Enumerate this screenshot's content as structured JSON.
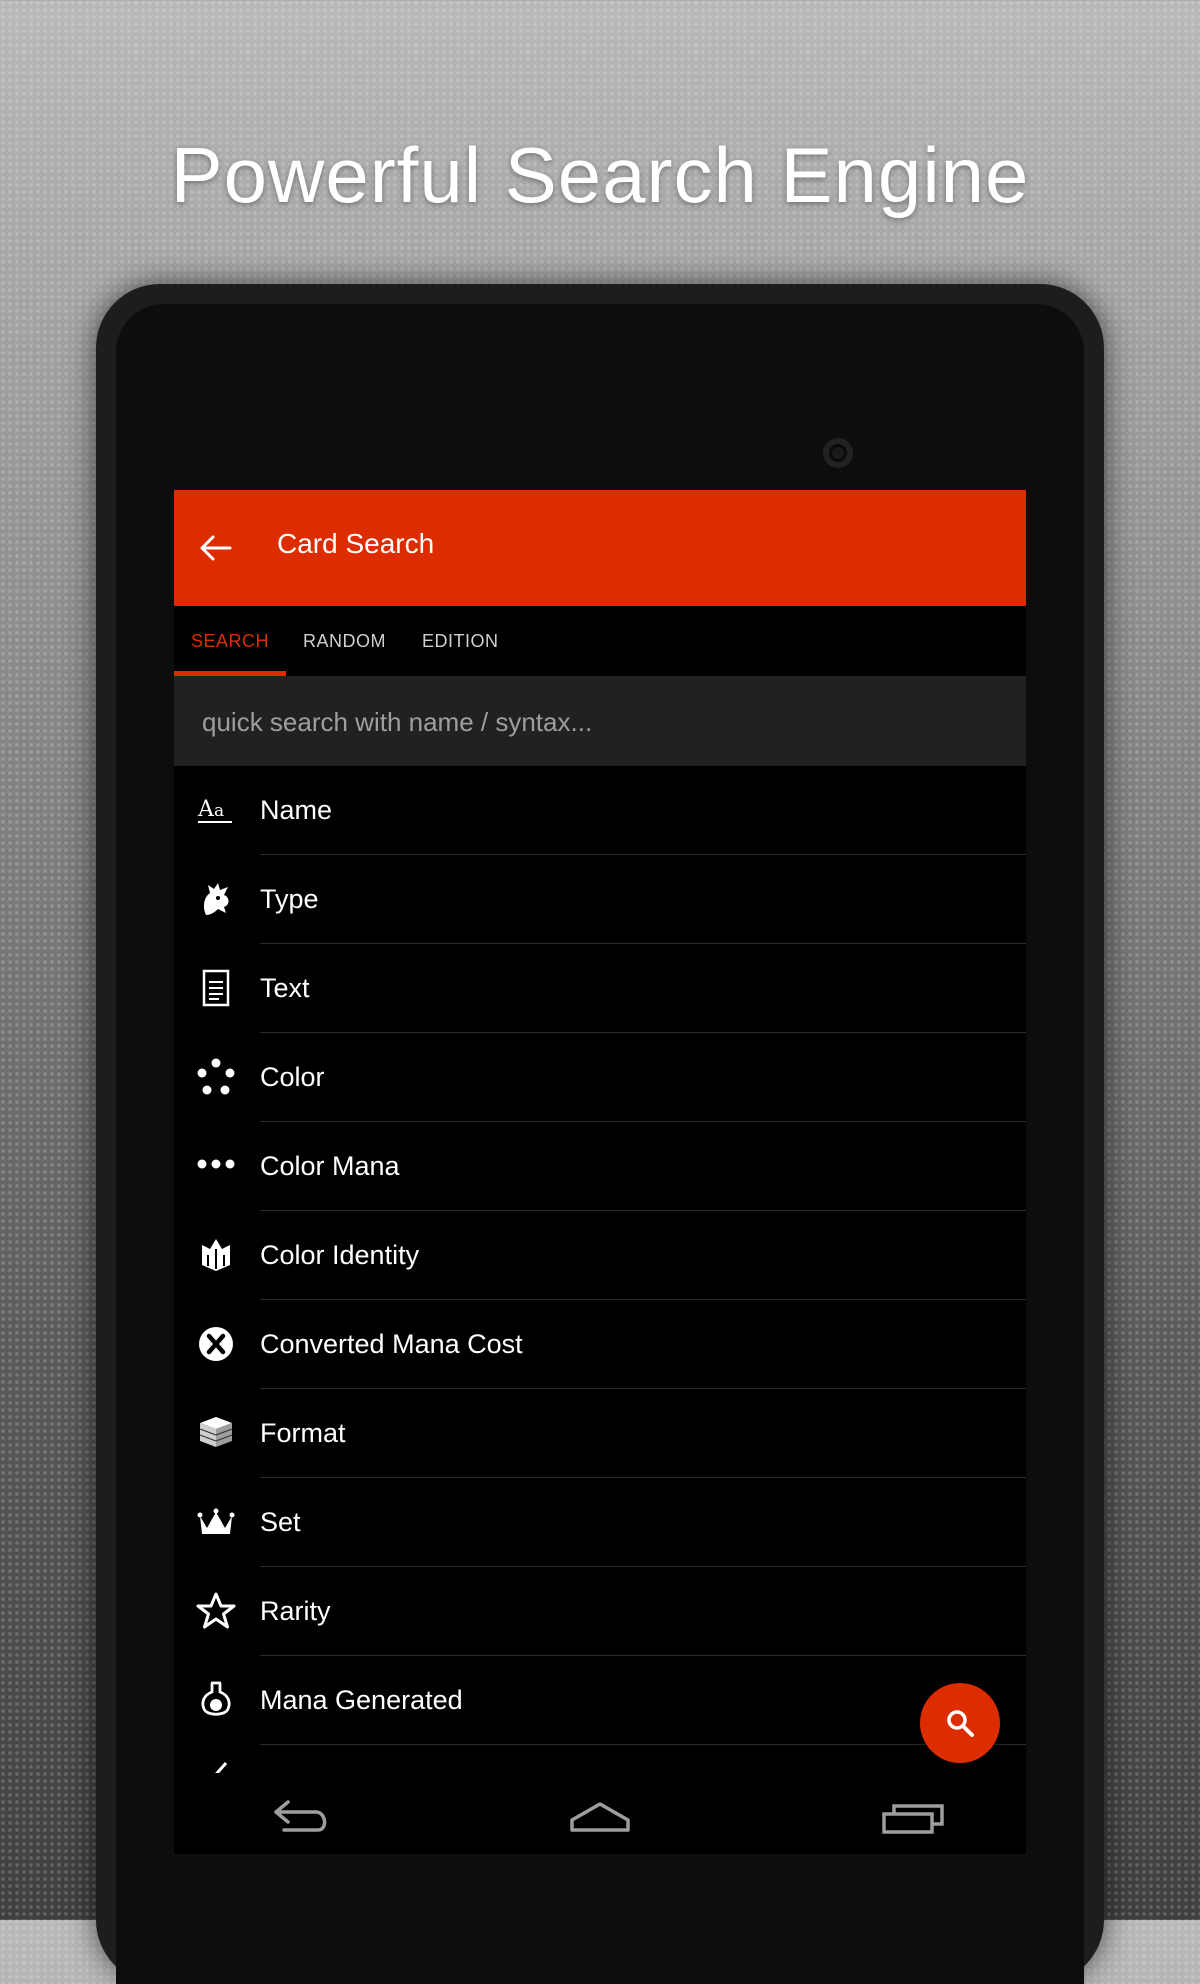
{
  "headline": "Powerful Search Engine",
  "appbar": {
    "title": "Card Search"
  },
  "tabs": [
    {
      "label": "SEARCH",
      "active": true
    },
    {
      "label": "RANDOM",
      "active": false
    },
    {
      "label": "EDITION",
      "active": false
    }
  ],
  "search": {
    "placeholder": "quick search with name / syntax...",
    "value": ""
  },
  "fields": [
    {
      "label": "Name",
      "icon": "text-format-icon"
    },
    {
      "label": "Type",
      "icon": "dragon-icon"
    },
    {
      "label": "Text",
      "icon": "document-icon"
    },
    {
      "label": "Color",
      "icon": "five-dots-icon"
    },
    {
      "label": "Color Mana",
      "icon": "three-dots-icon"
    },
    {
      "label": "Color Identity",
      "icon": "identity-icon"
    },
    {
      "label": "Converted Mana Cost",
      "icon": "x-circle-icon"
    },
    {
      "label": "Format",
      "icon": "card-stack-icon"
    },
    {
      "label": "Set",
      "icon": "crown-icon"
    },
    {
      "label": "Rarity",
      "icon": "star-icon"
    },
    {
      "label": "Mana Generated",
      "icon": "flask-icon"
    }
  ],
  "colors": {
    "accent": "#dd2c00",
    "background": "#000000",
    "search_bg": "#212121"
  }
}
